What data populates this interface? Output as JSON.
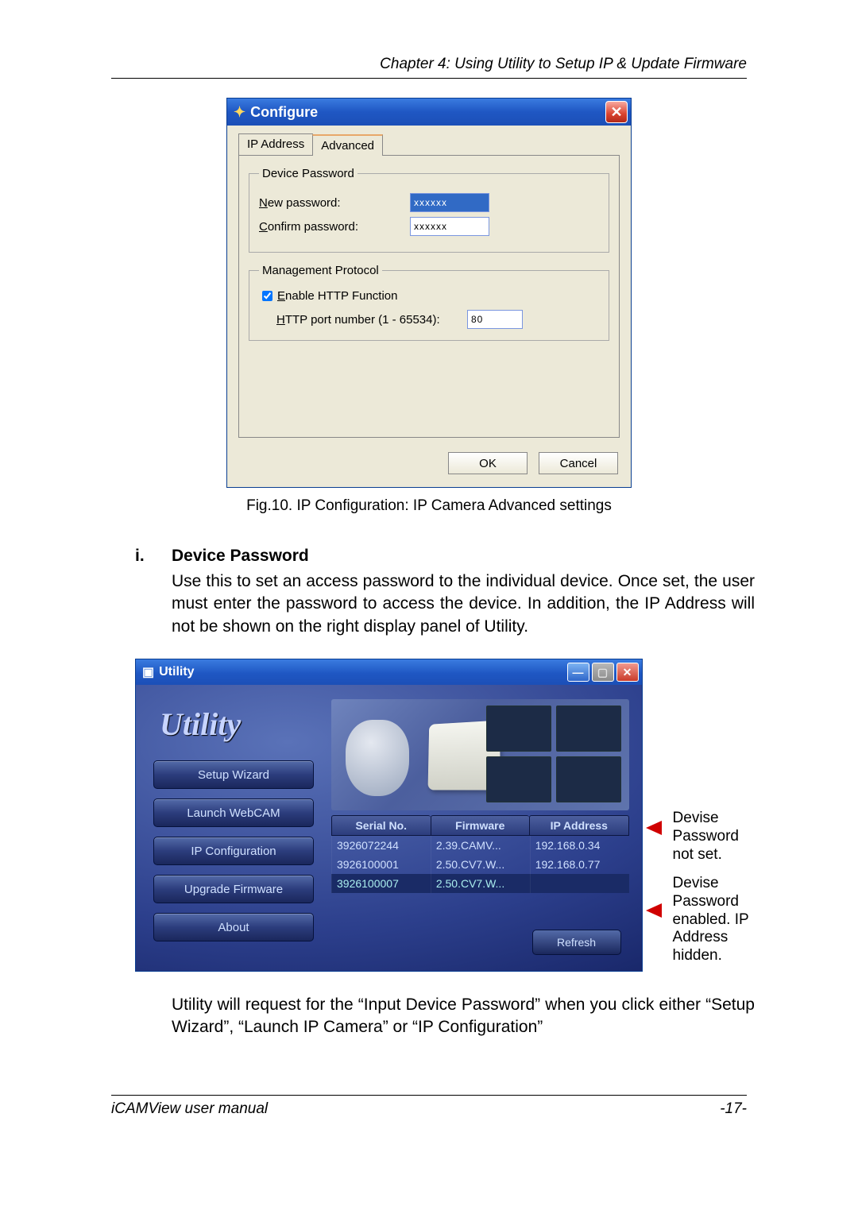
{
  "chapter_header": "Chapter 4: Using Utility to Setup IP & Update Firmware",
  "configure_dialog": {
    "title": "Configure",
    "tabs": {
      "ip_address": "IP Address",
      "advanced": "Advanced"
    },
    "device_password": {
      "legend": "Device Password",
      "new_label": "New password:",
      "new_value": "xxxxxx",
      "confirm_label": "Confirm password:",
      "confirm_value": "xxxxxx"
    },
    "management_protocol": {
      "legend": "Management Protocol",
      "enable_label": "Enable HTTP Function",
      "enable_checked": true,
      "port_label": "HTTP port number (1 - 65534):",
      "port_value": "80"
    },
    "buttons": {
      "ok": "OK",
      "cancel": "Cancel"
    }
  },
  "fig10_caption": "Fig.10.  IP Configuration: IP Camera Advanced settings",
  "section_i": {
    "num": "i.",
    "title": "Device Password",
    "body": "Use this to set an access password to the individual device.    Once set, the user must enter the password to access the device.   In addition, the IP Address will not be shown on the right display panel of Utility."
  },
  "utility_window": {
    "title": "Utility",
    "brand": "Utility",
    "nav": {
      "setup_wizard": "Setup Wizard",
      "launch_webcam": "Launch WebCAM",
      "ip_configuration": "IP Configuration",
      "upgrade_firmware": "Upgrade Firmware",
      "about": "About"
    },
    "table": {
      "headers": {
        "serial": "Serial No.",
        "firmware": "Firmware",
        "ip": "IP Address"
      },
      "rows": [
        {
          "serial": "3926072244",
          "firmware": "2.39.CAMV...",
          "ip": "192.168.0.34"
        },
        {
          "serial": "3926100001",
          "firmware": "2.50.CV7.W...",
          "ip": "192.168.0.77"
        },
        {
          "serial": "3926100007",
          "firmware": "2.50.CV7.W...",
          "ip": ""
        }
      ]
    },
    "refresh": "Refresh"
  },
  "callouts": {
    "not_set": "Devise Password not set.",
    "enabled": "Devise Password enabled. IP Address hidden."
  },
  "closing_para": "Utility will request for the “Input Device Password” when you click either “Setup Wizard”, “Launch IP Camera” or “IP Configuration”",
  "footer": {
    "left": "iCAMView  user  manual",
    "right": "-17-"
  }
}
